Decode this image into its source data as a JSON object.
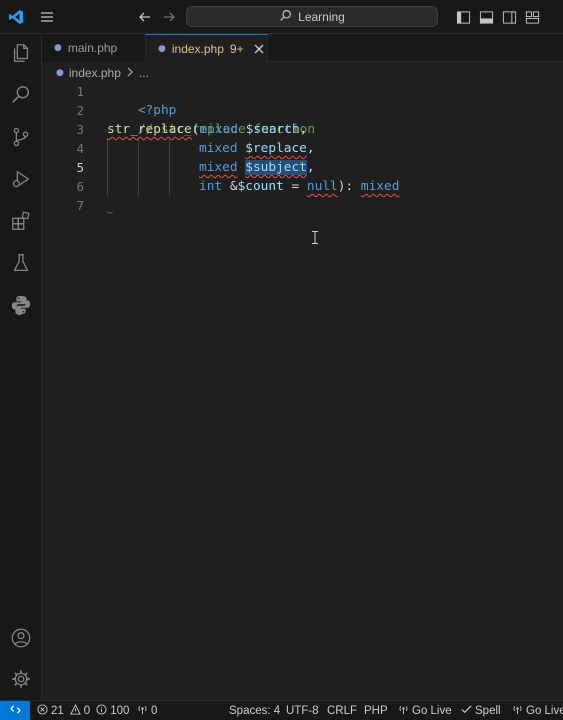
{
  "title_bar": {
    "search_text": "Learning",
    "icons": [
      "vscode-logo-icon",
      "menu-icon",
      "back-arrow-icon",
      "forward-arrow-icon",
      "search-icon",
      "toggle-primary-sidebar-icon",
      "toggle-panel-icon",
      "toggle-secondary-sidebar-icon",
      "customize-layout-icon"
    ]
  },
  "activity_bar": {
    "items": [
      "explorer-icon",
      "search-icon",
      "source-control-icon",
      "run-debug-icon",
      "extensions-icon",
      "testing-icon",
      "python-icon"
    ],
    "bottom": [
      "accounts-icon",
      "settings-gear-icon"
    ]
  },
  "tabs": [
    {
      "label": "main.php",
      "active": false
    },
    {
      "label": "index.php",
      "badge": "9+",
      "active": true
    }
  ],
  "breadcrumb": {
    "file": "index.php",
    "more": "..."
  },
  "editor": {
    "line_numbers": [
      "1",
      "2",
      "3",
      "4",
      "5",
      "6",
      "7"
    ],
    "current_line": "5",
    "code": {
      "l1_open_tag": "<?php",
      "l2_comment": "// str_replace function",
      "l3_func": "str_replace",
      "l3_paren": "(",
      "l3_type": "mixed",
      "l3_var": "$search",
      "l3_comma": ",",
      "l4_type": "mixed",
      "l4_var": "$replace",
      "l4_comma": ",",
      "l5_type": "mixed",
      "l5_var": "$subject",
      "l5_comma": ",",
      "l6_type": "int",
      "l6_amp": "&",
      "l6_var": "$count",
      "l6_eq": " = ",
      "l6_null": "null",
      "l6_close": "): ",
      "l6_ret": "mixed",
      "l8_tilde": "~"
    }
  },
  "status_bar": {
    "errors": "21",
    "warnings": "0",
    "info": "100",
    "ports": "0",
    "spaces": "Spaces: 4",
    "encoding": "UTF-8",
    "eol": "CRLF",
    "language": "PHP",
    "go_live_1": "Go Live",
    "spell": "Spell",
    "go_live_2": "Go Live"
  },
  "colors": {
    "accent": "#0078d4",
    "error_squiggle": "#f14c4c",
    "modified_tab": "#e2c08d"
  }
}
